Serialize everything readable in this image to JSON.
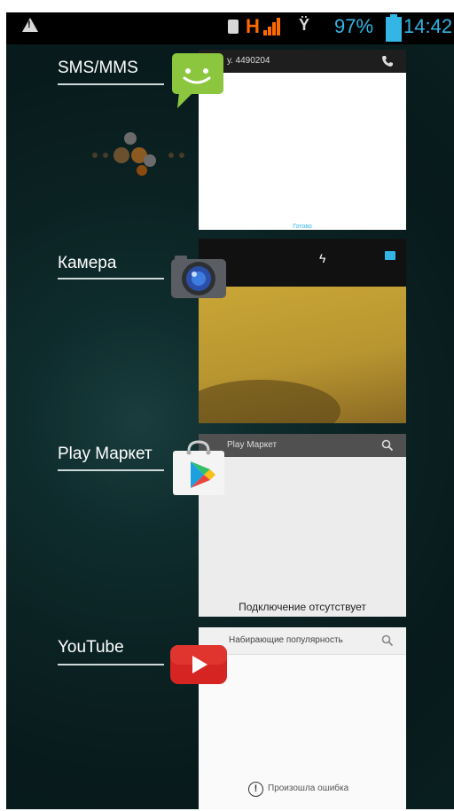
{
  "status_bar": {
    "network_type": "H",
    "battery_percent": "97%",
    "time": "14:42",
    "accent_color": "#33b5e5",
    "icons": [
      "warning-icon",
      "sim-icon",
      "signal-icon",
      "antenna-icon",
      "battery-icon"
    ]
  },
  "recent_apps": [
    {
      "name": "SMS/MMS",
      "icon": "messaging-icon",
      "preview_title": "у. 4490204",
      "preview_icon": "phone-icon",
      "preview_footer": "Готово"
    },
    {
      "name": "Камера",
      "icon": "camera-icon",
      "preview_icons": [
        "flash-icon",
        "gallery-icon"
      ]
    },
    {
      "name": "Play Маркет",
      "icon": "play-store-icon",
      "preview_title": "Play Маркет",
      "preview_icon": "search-icon",
      "preview_message": "Подключение отсутствует"
    },
    {
      "name": "YouTube",
      "icon": "youtube-icon",
      "preview_title": "Набирающие популярность",
      "preview_icon": "search-icon",
      "preview_message": "Произошла ошибка"
    }
  ]
}
